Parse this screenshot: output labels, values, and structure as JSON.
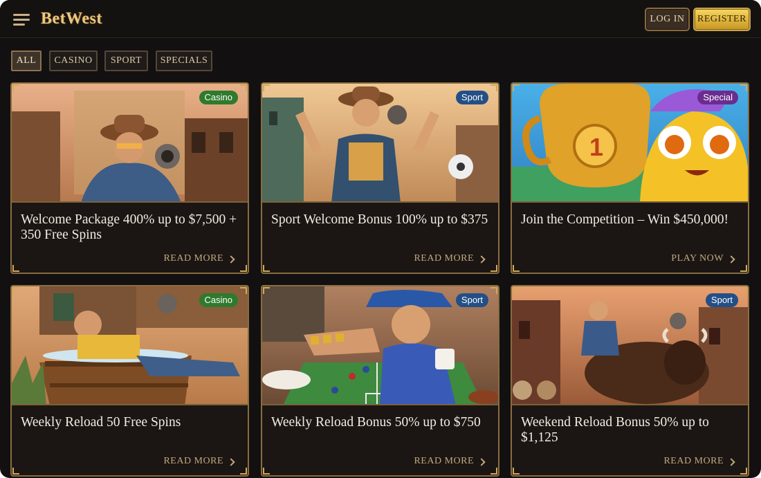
{
  "header": {
    "logo_text": "BetWest",
    "login_label": "LOG IN",
    "register_label": "REGISTER"
  },
  "filters": {
    "items": [
      {
        "label": "ALL",
        "active": true
      },
      {
        "label": "CASINO",
        "active": false
      },
      {
        "label": "SPORT",
        "active": false
      },
      {
        "label": "SPECIALS",
        "active": false
      }
    ]
  },
  "cards": [
    {
      "badge": "Casino",
      "title": "Welcome Package 400% up to $7,500 + 350 Free Spins",
      "cta": "READ MORE"
    },
    {
      "badge": "Sport",
      "title": "Sport Welcome Bonus 100% up to $375",
      "cta": "READ MORE"
    },
    {
      "badge": "Special",
      "title": "Join the Competition – Win $450,000!",
      "cta": "PLAY NOW"
    },
    {
      "badge": "Casino",
      "title": "Weekly Reload 50 Free Spins",
      "cta": "READ MORE"
    },
    {
      "badge": "Sport",
      "title": "Weekly Reload Bonus 50% up to $750",
      "cta": "READ MORE"
    },
    {
      "badge": "Sport",
      "title": "Weekend Reload Bonus 50% up to $1,125",
      "cta": "READ MORE"
    }
  ],
  "theme": {
    "background": "#121010",
    "gold": "#d1a85a",
    "casino_badge": "#2f7a2c",
    "sport_badge": "#234f86",
    "special_badge": "#6b2c8f"
  }
}
